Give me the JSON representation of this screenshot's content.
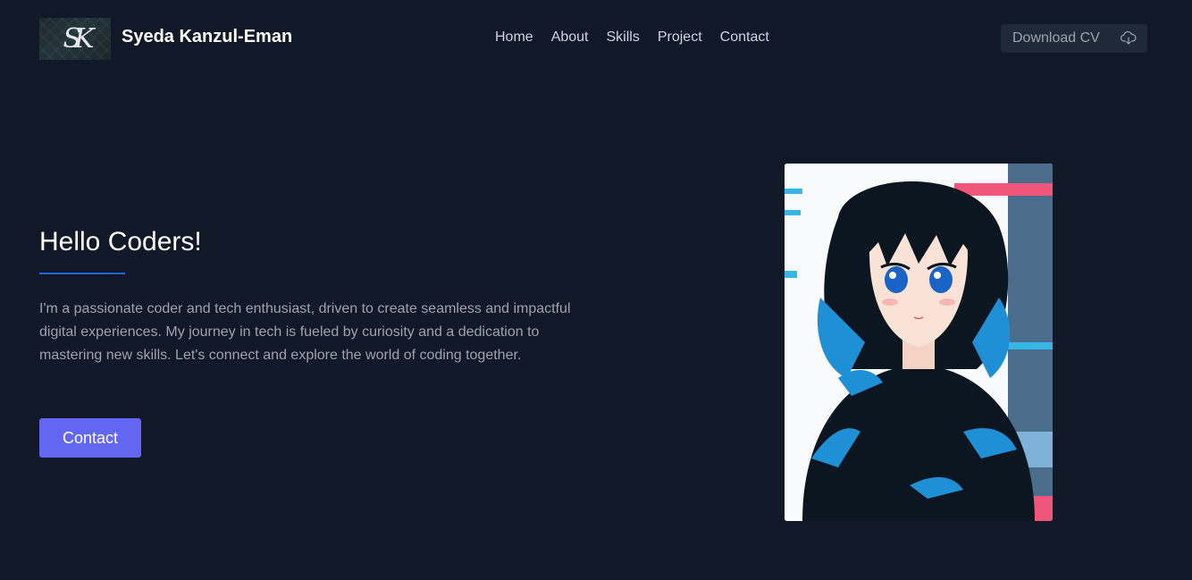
{
  "header": {
    "logo_monogram": "SK",
    "site_name": "Syeda Kanzul-Eman",
    "nav": [
      "Home",
      "About",
      "Skills",
      "Project",
      "Contact"
    ],
    "download_label": "Download CV"
  },
  "hero": {
    "title": "Hello Coders!",
    "description": "I'm a passionate coder and tech enthusiast, driven to create seamless and impactful digital experiences. My journey in tech is fueled by curiosity and a dedication to mastering new skills. Let's connect and explore the world of coding together.",
    "contact_label": "Contact"
  },
  "colors": {
    "background": "#111827",
    "accent": "#6366f1",
    "divider": "#2563eb"
  },
  "icons": {
    "download": "cloud-download-icon"
  }
}
